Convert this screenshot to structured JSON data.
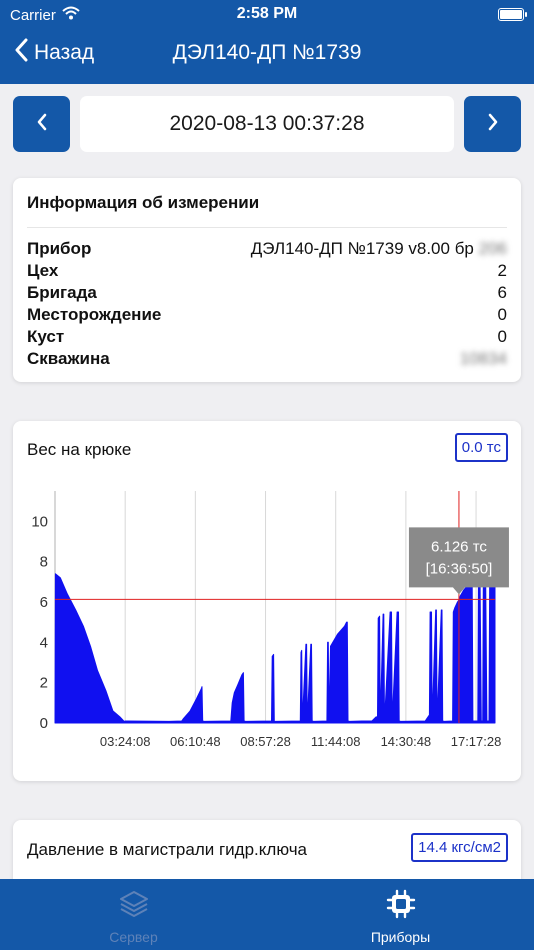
{
  "status_bar": {
    "carrier": "Carrier",
    "time": "2:58 PM"
  },
  "nav": {
    "back_label": "Назад",
    "title": "ДЭЛ140-ДП №1739"
  },
  "date_selector": {
    "value": "2020-08-13 00:37:28"
  },
  "info_card": {
    "title": "Информация об измерении",
    "rows": [
      {
        "key": "Прибор",
        "value": "ДЭЛ140-ДП №1739 v8.00 бр",
        "blurred_suffix": "206"
      },
      {
        "key": "Цех",
        "value": "2"
      },
      {
        "key": "Бригада",
        "value": "6"
      },
      {
        "key": "Месторождение",
        "value": "0"
      },
      {
        "key": "Куст",
        "value": "0"
      },
      {
        "key": "Скважина",
        "value": "",
        "blurred_suffix": "10834"
      }
    ]
  },
  "hook_weight_card": {
    "title": "Вес на крюке",
    "current_value": "0.0 тс",
    "tooltip": {
      "value": "6.126 тс",
      "time": "[16:36:50]"
    }
  },
  "pressure_card": {
    "title": "Давление в магистрали гидр.ключа",
    "current_value": "14.4 кгс/см2"
  },
  "tabbar": {
    "items": [
      {
        "label": "Сервер",
        "icon": "layers-icon",
        "active": false
      },
      {
        "label": "Приборы",
        "icon": "chip-icon",
        "active": true
      }
    ]
  },
  "colors": {
    "primary": "#1458a8",
    "series": "#1010f0",
    "crosshair": "#e02020",
    "badge": "#1c32c8",
    "tooltip_bg": "#8a8a8a"
  },
  "chart_data": {
    "type": "area",
    "ylim": [
      0,
      11.5
    ],
    "yticks": [
      "0",
      "2",
      "4",
      "6",
      "8",
      "10"
    ],
    "xticks": [
      "03:24:08",
      "06:10:48",
      "08:57:28",
      "11:44:08",
      "14:30:48",
      "17:17:28"
    ],
    "xtick_seconds": [
      12248,
      22248,
      32248,
      42248,
      52248,
      62248
    ],
    "x_range_seconds": [
      2248,
      64948
    ],
    "crosshair": {
      "x_seconds": 59810,
      "y": 6.126
    },
    "series": [
      {
        "values": [
          [
            2248,
            0
          ],
          [
            2300,
            7.4
          ],
          [
            3000,
            7.2
          ],
          [
            4000,
            6.4
          ],
          [
            5200,
            5.6
          ],
          [
            6300,
            4.8
          ],
          [
            7300,
            3.8
          ],
          [
            8300,
            2.6
          ],
          [
            9500,
            1.6
          ],
          [
            10500,
            0.6
          ],
          [
            11500,
            0.3
          ],
          [
            12100,
            0.08
          ],
          [
            12300,
            0.1
          ],
          [
            18500,
            0.08
          ],
          [
            20300,
            0.1
          ],
          [
            20500,
            0.2
          ],
          [
            21500,
            0.6
          ],
          [
            22400,
            1.2
          ],
          [
            23100,
            1.7
          ],
          [
            23200,
            1.8
          ],
          [
            23300,
            0.1
          ],
          [
            23500,
            0.08
          ],
          [
            27300,
            0.1
          ],
          [
            27500,
            1.0
          ],
          [
            27800,
            1.5
          ],
          [
            28300,
            1.9
          ],
          [
            28900,
            2.4
          ],
          [
            29100,
            2.5
          ],
          [
            29200,
            0.1
          ],
          [
            29400,
            0.08
          ],
          [
            33100,
            0.1
          ],
          [
            33200,
            3.3
          ],
          [
            33400,
            3.4
          ],
          [
            33500,
            0.1
          ],
          [
            33600,
            0.08
          ],
          [
            37200,
            0.1
          ],
          [
            37300,
            3.5
          ],
          [
            37400,
            3.6
          ],
          [
            37500,
            0.1
          ],
          [
            38000,
            3.9
          ],
          [
            38100,
            3.9
          ],
          [
            38200,
            0.1
          ],
          [
            38700,
            3.9
          ],
          [
            38800,
            3.9
          ],
          [
            38900,
            0.1
          ],
          [
            39100,
            0.08
          ],
          [
            41000,
            0.1
          ],
          [
            41100,
            4.0
          ],
          [
            41200,
            4.0
          ],
          [
            41300,
            0.1
          ],
          [
            41500,
            3.8
          ],
          [
            42000,
            4.1
          ],
          [
            42500,
            4.4
          ],
          [
            43000,
            4.6
          ],
          [
            43500,
            4.8
          ],
          [
            43800,
            5.0
          ],
          [
            43900,
            5.0
          ],
          [
            44000,
            0.1
          ],
          [
            44200,
            0.08
          ],
          [
            46000,
            0.1
          ],
          [
            47400,
            0.1
          ],
          [
            48000,
            0.3
          ],
          [
            48200,
            0.3
          ],
          [
            48300,
            5.2
          ],
          [
            48500,
            5.3
          ],
          [
            48600,
            0.1
          ],
          [
            49000,
            5.4
          ],
          [
            49100,
            5.4
          ],
          [
            49200,
            0.1
          ],
          [
            50000,
            5.5
          ],
          [
            50200,
            5.5
          ],
          [
            50300,
            0.1
          ],
          [
            51000,
            5.5
          ],
          [
            51200,
            5.5
          ],
          [
            51300,
            0.1
          ],
          [
            51500,
            0.08
          ],
          [
            55000,
            0.1
          ],
          [
            55400,
            0.3
          ],
          [
            55600,
            0.4
          ],
          [
            55700,
            5.5
          ],
          [
            55900,
            5.5
          ],
          [
            56000,
            0.1
          ],
          [
            56500,
            5.6
          ],
          [
            56600,
            5.6
          ],
          [
            56700,
            0.1
          ],
          [
            57300,
            5.6
          ],
          [
            57400,
            5.6
          ],
          [
            57500,
            0.1
          ],
          [
            57700,
            0.08
          ],
          [
            58900,
            0.1
          ],
          [
            59000,
            5.5
          ],
          [
            59200,
            5.7
          ],
          [
            59600,
            6.0
          ],
          [
            59810,
            6.1
          ],
          [
            60000,
            6.3
          ],
          [
            60500,
            6.6
          ],
          [
            61000,
            6.8
          ],
          [
            61500,
            7.0
          ],
          [
            61700,
            7.0
          ],
          [
            61800,
            0.1
          ],
          [
            62500,
            0.1
          ],
          [
            62600,
            7.8
          ],
          [
            62800,
            7.9
          ],
          [
            63000,
            0.1
          ],
          [
            63200,
            0.1
          ],
          [
            63300,
            8.0
          ],
          [
            63600,
            8.1
          ],
          [
            63800,
            0.1
          ],
          [
            64100,
            0.1
          ],
          [
            64200,
            8.3
          ],
          [
            64500,
            8.4
          ],
          [
            64948,
            8.4
          ],
          [
            64948,
            0
          ]
        ]
      }
    ],
    "grid": "vertical",
    "legend": "none"
  }
}
